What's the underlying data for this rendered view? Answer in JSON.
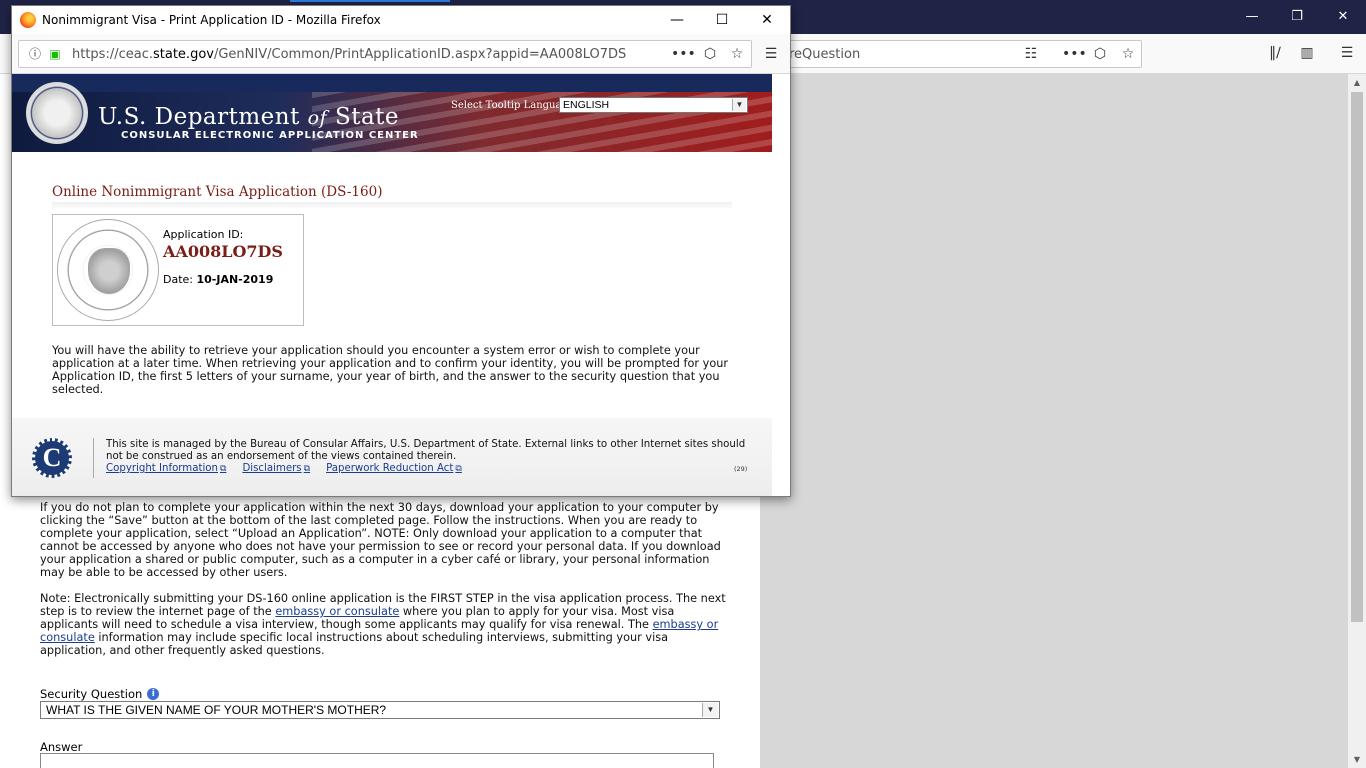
{
  "main_window": {
    "url_partial": "reQuestion",
    "window_controls": {
      "minimize": "—",
      "restore": "❐",
      "close": "✕"
    },
    "body_paragraph_1": "If you do not plan to complete your application within the next 30 days, download your application to your computer by clicking the “Save” button at the bottom of the last completed page. Follow the instructions. When you are ready to complete your application, select “Upload an Application”. NOTE: Only download your application to a computer that cannot be accessed by anyone who does not have your permission to see or record your personal data. If you download your application a shared or public computer, such as a computer in a cyber café or library, your personal information may be able to be accessed by other users.",
    "body_paragraph_2_a": "Note: Electronically submitting your DS-160 online application is the FIRST STEP in the visa application process. The next step is to review the internet page of the ",
    "body_link_1": "embassy or consulate",
    "body_paragraph_2_b": " where you plan to apply for your visa. Most visa applicants will need to schedule a visa interview, though some applicants may qualify for visa renewal. The ",
    "body_link_2": "embassy or consulate",
    "body_paragraph_2_c": " information may include specific local instructions about scheduling interviews, submitting your visa application, and other frequently asked questions.",
    "security_question_label": "Security Question",
    "security_question_info": "i",
    "security_question_value": "WHAT IS THE GIVEN NAME OF YOUR MOTHER'S MOTHER?",
    "answer_label": "Answer",
    "answer_value": ""
  },
  "popup": {
    "title": "Nonimmigrant Visa - Print Application ID - Mozilla Firefox",
    "window_controls": {
      "minimize": "—",
      "maximize": "☐",
      "close": "✕"
    },
    "url_host": "https://ceac.",
    "url_domain": "state.gov",
    "url_path": "/GenNIV/Common/PrintApplicationID.aspx?appid=AA008LO7DS",
    "header": {
      "dept_part_1": "U.S. Department ",
      "dept_of": "of",
      "dept_part_2": " State",
      "subtitle": "CONSULAR ELECTRONIC APPLICATION CENTER",
      "tooltip_language_label": "Select Tooltip Language",
      "tooltip_language_value": "ENGLISH"
    },
    "app_heading": "Online Nonimmigrant Visa Application (DS-160)",
    "application_id_label": "Application ID:",
    "application_id": "AA008LO7DS",
    "date_label": "Date:",
    "date_value": "10-JAN-2019",
    "retrieve_text": "You will have the ability to retrieve your application should you encounter a system error or wish to complete your application at a later time. When retrieving your application and to confirm your identity, you will be prompted for your Application ID, the first 5 letters of your surname, your year of birth, and the answer to the security question that you selected.",
    "footer": {
      "logo_letter": "C",
      "text": "This site is managed by the Bureau of Consular Affairs, U.S. Department of State. External links to other Internet sites should not be construed as an endorsement of the views contained therein.",
      "links": [
        "Copyright Information",
        "Disclaimers",
        "Paperwork Reduction Act"
      ],
      "version": "(29)"
    }
  },
  "colors": {
    "heading_red": "#7a1d16",
    "link_blue": "#1a3d8f",
    "titlebar_dark": "#1f2346"
  },
  "icons": [
    "firefox-icon",
    "info-icon",
    "lock-icon",
    "more-icon",
    "pocket-icon",
    "star-icon",
    "menu-icon",
    "library-icon",
    "sidebar-icon",
    "reader-icon",
    "external-link-icon"
  ]
}
